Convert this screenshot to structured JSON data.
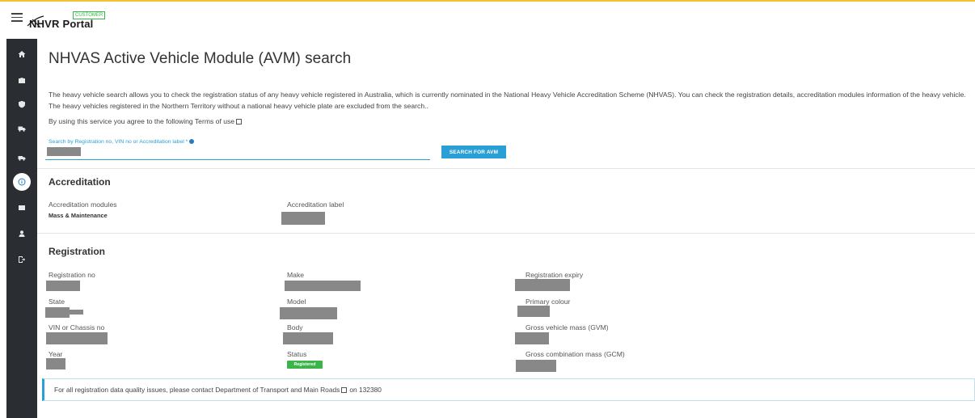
{
  "header": {
    "logo_text": "NHVR Portal",
    "logo_badge": "CUSTOMER"
  },
  "page": {
    "title": "NHVAS Active Vehicle Module (AVM) search",
    "intro": "The heavy vehicle search allows you to check the registration status of any heavy vehicle registered in Australia, which is currently nominated in the National Heavy Vehicle Accreditation Scheme (NHVAS). You can check the registration details, accreditation modules information of the heavy vehicle. The heavy vehicles registered in the Northern Territory without a national heavy vehicle plate are excluded from the search..",
    "terms": "By using this service you agree to the following Terms of use"
  },
  "search": {
    "label": "Search by Registration no, VIN no or Accreditation label *",
    "button": "SEARCH FOR AVM"
  },
  "accreditation": {
    "heading": "Accreditation",
    "modules_label": "Accreditation modules",
    "modules_value": "Mass & Maintenance",
    "label_label": "Accreditation label"
  },
  "registration": {
    "heading": "Registration",
    "fields": {
      "rego": "Registration no",
      "make": "Make",
      "expiry": "Registration expiry",
      "state": "State",
      "model": "Model",
      "colour": "Primary colour",
      "vin": "VIN or Chassis no",
      "body": "Body",
      "gvm": "Gross vehicle mass (GVM)",
      "year": "Year",
      "status": "Status",
      "gcm": "Gross combination mass (GCM)"
    },
    "status_badge": "Registered"
  },
  "notice": {
    "text": "For all registration data quality issues, please contact Department of Transport and Main Roads",
    "suffix": "on 132380"
  },
  "colors": {
    "accent": "#2a9fd6",
    "sidebar": "#2a2d31",
    "success": "#3bb54a",
    "topline": "#f1c232"
  },
  "sidebar_icons": [
    "home-icon",
    "briefcase-icon",
    "shield-icon",
    "truck-plus-icon",
    "truck-icon",
    "info-icon",
    "id-card-icon",
    "user-icon",
    "logout-icon"
  ]
}
